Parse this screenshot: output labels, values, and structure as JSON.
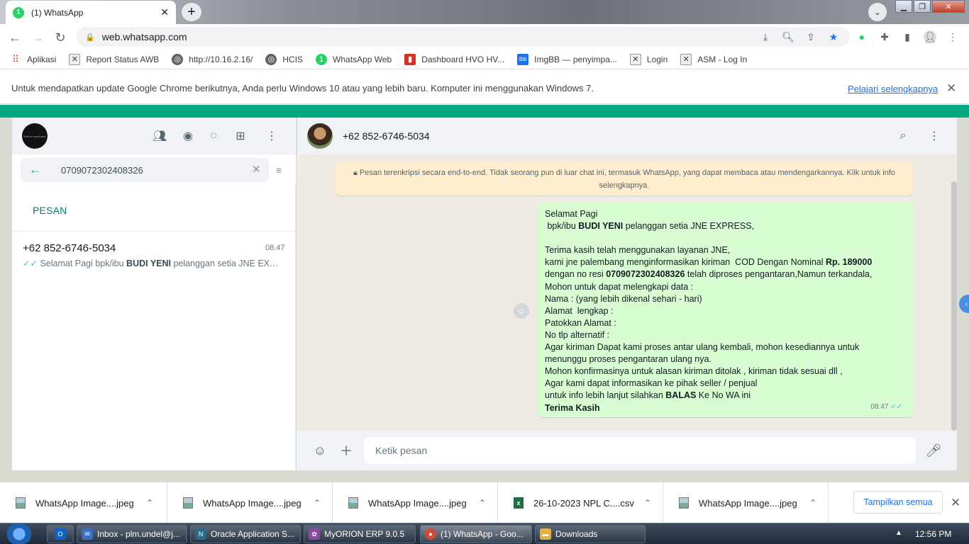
{
  "browser": {
    "tab_title": "(1) WhatsApp",
    "tab_badge": "1",
    "url": "web.whatsapp.com",
    "bookmarks": [
      {
        "label": "Aplikasi",
        "icon": "apps-grid-icon"
      },
      {
        "label": "Report Status AWB",
        "icon": "page-icon"
      },
      {
        "label": "http://10.16.2.16/",
        "icon": "globe-icon"
      },
      {
        "label": "HCIS",
        "icon": "globe-icon"
      },
      {
        "label": "WhatsApp Web",
        "icon": "whatsapp-icon"
      },
      {
        "label": "Dashboard HVO HV...",
        "icon": "dashboard-icon"
      },
      {
        "label": "ImgBB — penyimpa...",
        "icon": "imgbb-icon"
      },
      {
        "label": "Login",
        "icon": "page-icon"
      },
      {
        "label": "ASM - Log In",
        "icon": "page-icon"
      }
    ],
    "infobar": {
      "message": "Untuk mendapatkan update Google Chrome berikutnya, Anda perlu Windows 10 atau yang lebih baru. Komputer ini menggunakan Windows 7.",
      "link": "Pelajari selengkapnya"
    }
  },
  "sidebar": {
    "search_value": "0709072302408326",
    "section_label": "PESAN",
    "result": {
      "name": "+62 852-6746-5034",
      "time": "08.47",
      "snippet_prefix": "Selamat Pagi  bpk/ibu ",
      "snippet_bold": "BUDI YENI",
      "snippet_suffix": " pelanggan setia JNE EXPR..."
    }
  },
  "chat": {
    "contact": "+62 852-6746-5034",
    "encryption_notice": "Pesan terenkripsi secara end-to-end. Tidak seorang pun di luar chat ini, termasuk WhatsApp, yang dapat membaca atau mendengarkannya. Klik untuk info selengkapnya.",
    "message_time": "08.47",
    "message_lines": [
      {
        "parts": [
          {
            "t": "Selamat Pagi"
          }
        ]
      },
      {
        "parts": [
          {
            "t": " bpk/ibu "
          },
          {
            "t": "BUDI YENI",
            "b": true
          },
          {
            "t": " pelanggan setia JNE EXPRESS,"
          }
        ]
      },
      {
        "parts": [
          {
            "t": ""
          }
        ]
      },
      {
        "parts": [
          {
            "t": "Terima kasih telah menggunakan layanan JNE,"
          }
        ]
      },
      {
        "parts": [
          {
            "t": "kami jne palembang menginformasikan kiriman  COD Dengan Nominal "
          },
          {
            "t": "Rp. 189000",
            "b": true
          }
        ]
      },
      {
        "parts": [
          {
            "t": "dengan no resi "
          },
          {
            "t": "0709072302408326",
            "b": true
          },
          {
            "t": " telah diproses pengantaran,Namun terkandala,"
          }
        ]
      },
      {
        "parts": [
          {
            "t": "Mohon untuk dapat melengkapi data :"
          }
        ]
      },
      {
        "parts": [
          {
            "t": "Nama : (yang lebih dikenal sehari - hari)"
          }
        ]
      },
      {
        "parts": [
          {
            "t": "Alamat  lengkap :"
          }
        ]
      },
      {
        "parts": [
          {
            "t": "Patokkan Alamat :"
          }
        ]
      },
      {
        "parts": [
          {
            "t": "No tlp alternatif :"
          }
        ]
      },
      {
        "parts": [
          {
            "t": "Agar kiriman Dapat kami proses antar ulang kembali, mohon kesediannya untuk"
          }
        ]
      },
      {
        "parts": [
          {
            "t": "menunggu proses pengantaran ulang nya."
          }
        ]
      },
      {
        "parts": [
          {
            "t": "Mohon konfirmasinya untuk alasan kiriman ditolak , kiriman tidak sesuai dll ,"
          }
        ]
      },
      {
        "parts": [
          {
            "t": "Agar kami dapat informasikan ke pihak seller / penjual"
          }
        ]
      },
      {
        "parts": [
          {
            "t": "untuk info lebih lanjut silahkan "
          },
          {
            "t": "BALAS",
            "b": true
          },
          {
            "t": " Ke No WA ini"
          }
        ]
      },
      {
        "parts": [
          {
            "t": "Terima Kasih",
            "b": true
          }
        ]
      }
    ],
    "input_placeholder": "Ketik pesan"
  },
  "downloads": {
    "items": [
      {
        "name": "WhatsApp Image....jpeg",
        "type": "image"
      },
      {
        "name": "WhatsApp Image....jpeg",
        "type": "image"
      },
      {
        "name": "WhatsApp Image....jpeg",
        "type": "image"
      },
      {
        "name": "26-10-2023 NPL C....csv",
        "type": "excel"
      },
      {
        "name": "WhatsApp Image....jpeg",
        "type": "image"
      }
    ],
    "show_all": "Tampilkan semua"
  },
  "taskbar": {
    "items": [
      {
        "label": "Inbox - plm.undel@j...",
        "color": "#3a6fc4"
      },
      {
        "label": "Oracle Application S...",
        "color": "#2a6a8a"
      },
      {
        "label": "MyORION ERP 9.0.5",
        "color": "#8a4aa0"
      },
      {
        "label": "(1) WhatsApp - Goo...",
        "color": "#d04a3a"
      },
      {
        "label": "Downloads",
        "color": "#e0b040"
      }
    ],
    "clock": "12:56 PM"
  }
}
